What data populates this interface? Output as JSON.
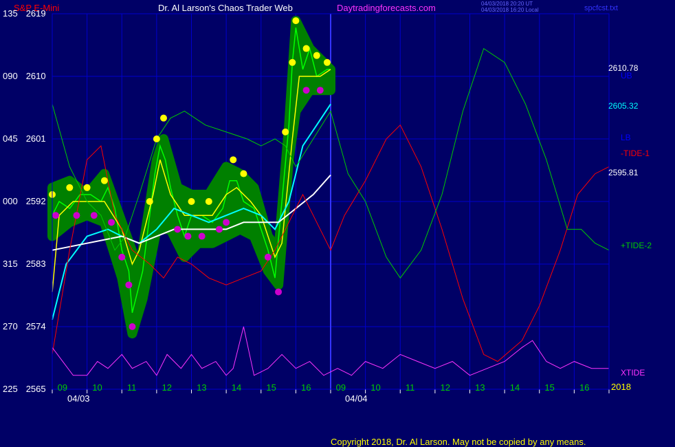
{
  "header": {
    "instrument": "S&P E-Mini",
    "title": "Dr. Al Larson's Chaos Trader Web",
    "site": "Daytradingforecasts.com",
    "stamp1": "04/03/2018 20:20 UT",
    "stamp2": "04/03/2018 16:20 Local",
    "file": "spcfcst.txt"
  },
  "colors": {
    "background": "#000066",
    "grid": "#0000cc",
    "price": "#00ff00",
    "band": "#008000",
    "highs": "#ffff00",
    "lows": "#cc00cc",
    "fast_ma": "#ffff00",
    "mid_ma": "#00ffff",
    "slow_ma": "#ffffff",
    "tide1": "#ff0000",
    "tide2": "#00cc00",
    "xtide": "#ff33ff"
  },
  "right_labels": {
    "ub": "UB",
    "ub_value": "2610.78",
    "ma_value": "2605.32",
    "lb": "LB",
    "tide1": "-TIDE-1",
    "last_value": "2595.81",
    "tide2": "+TIDE-2",
    "xtide": "XTIDE",
    "year": "2018"
  },
  "copyright": "Copyright 2018, Dr. Al Larson. May not be copied by any means.",
  "chart_data": {
    "type": "line",
    "y_ticks": [
      {
        "angle": "135",
        "price": "2619"
      },
      {
        "angle": "090",
        "price": "2610"
      },
      {
        "angle": "045",
        "price": "2601"
      },
      {
        "angle": "000",
        "price": "2592"
      },
      {
        "angle": "315",
        "price": "2583"
      },
      {
        "angle": "270",
        "price": "2574"
      },
      {
        "angle": "225",
        "price": "2565"
      }
    ],
    "x_ticks": [
      "09",
      "10",
      "11",
      "12",
      "13",
      "14",
      "15",
      "16",
      "09",
      "10",
      "11",
      "12",
      "13",
      "14",
      "15",
      "16"
    ],
    "dates": [
      "04/03",
      "04/04"
    ],
    "ylim": [
      2565,
      2619
    ],
    "hours_domain": [
      8,
      24
    ],
    "grid": true,
    "price_path": [
      [
        8.0,
        2590
      ],
      [
        8.2,
        2592
      ],
      [
        8.5,
        2591
      ],
      [
        8.8,
        2593
      ],
      [
        9.1,
        2593
      ],
      [
        9.4,
        2592
      ],
      [
        9.6,
        2594
      ],
      [
        9.8,
        2591
      ],
      [
        10.0,
        2585
      ],
      [
        10.2,
        2582
      ],
      [
        10.3,
        2576
      ],
      [
        10.4,
        2578
      ],
      [
        10.6,
        2582
      ],
      [
        10.8,
        2590
      ],
      [
        10.95,
        2596
      ],
      [
        11.1,
        2600
      ],
      [
        11.25,
        2598
      ],
      [
        11.4,
        2594
      ],
      [
        11.6,
        2590
      ],
      [
        11.8,
        2587
      ],
      [
        12.0,
        2590
      ],
      [
        12.3,
        2590
      ],
      [
        12.6,
        2589
      ],
      [
        12.9,
        2591
      ],
      [
        13.1,
        2595
      ],
      [
        13.3,
        2595
      ],
      [
        13.5,
        2592
      ],
      [
        13.8,
        2591
      ],
      [
        14.0,
        2588
      ],
      [
        14.2,
        2585
      ],
      [
        14.4,
        2581
      ],
      [
        14.6,
        2592
      ],
      [
        14.8,
        2603
      ],
      [
        14.9,
        2612
      ],
      [
        15.0,
        2617
      ],
      [
        15.2,
        2611
      ],
      [
        15.4,
        2614
      ],
      [
        15.6,
        2610
      ],
      [
        15.9,
        2611
      ],
      [
        16.0,
        2611
      ]
    ],
    "upper_channel": [
      [
        8.0,
        2594
      ],
      [
        8.5,
        2595
      ],
      [
        9.0,
        2593
      ],
      [
        9.5,
        2596
      ],
      [
        10.0,
        2589
      ],
      [
        10.5,
        2582
      ],
      [
        11.0,
        2598
      ],
      [
        11.2,
        2601
      ],
      [
        11.6,
        2594
      ],
      [
        12.0,
        2593
      ],
      [
        12.5,
        2593
      ],
      [
        13.0,
        2597
      ],
      [
        13.4,
        2596
      ],
      [
        13.8,
        2594
      ],
      [
        14.2,
        2587
      ],
      [
        14.5,
        2585
      ],
      [
        14.8,
        2603
      ],
      [
        15.0,
        2618
      ],
      [
        15.4,
        2614
      ],
      [
        15.8,
        2612
      ],
      [
        16.0,
        2611
      ]
    ],
    "lower_channel": [
      [
        8.0,
        2587
      ],
      [
        8.5,
        2589
      ],
      [
        9.0,
        2590
      ],
      [
        9.5,
        2589
      ],
      [
        10.0,
        2581
      ],
      [
        10.3,
        2573
      ],
      [
        10.6,
        2578
      ],
      [
        11.0,
        2588
      ],
      [
        11.4,
        2588
      ],
      [
        11.8,
        2584
      ],
      [
        12.2,
        2586
      ],
      [
        12.6,
        2586
      ],
      [
        13.0,
        2587
      ],
      [
        13.4,
        2588
      ],
      [
        13.8,
        2587
      ],
      [
        14.2,
        2582
      ],
      [
        14.5,
        2580
      ],
      [
        14.8,
        2598
      ],
      [
        15.0,
        2605
      ],
      [
        15.4,
        2608
      ],
      [
        15.8,
        2608
      ],
      [
        16.0,
        2608
      ]
    ],
    "highs": [
      [
        8.0,
        2593
      ],
      [
        8.5,
        2594
      ],
      [
        9.0,
        2594
      ],
      [
        9.5,
        2595
      ],
      [
        10.8,
        2592
      ],
      [
        11.0,
        2601
      ],
      [
        11.2,
        2604
      ],
      [
        12.0,
        2592
      ],
      [
        12.5,
        2592
      ],
      [
        13.2,
        2598
      ],
      [
        13.5,
        2596
      ],
      [
        14.7,
        2602
      ],
      [
        14.9,
        2612
      ],
      [
        15.0,
        2618
      ],
      [
        15.3,
        2614
      ],
      [
        15.6,
        2613
      ],
      [
        15.9,
        2612
      ]
    ],
    "lows": [
      [
        8.1,
        2590
      ],
      [
        8.7,
        2590
      ],
      [
        9.2,
        2590
      ],
      [
        9.7,
        2589
      ],
      [
        10.0,
        2584
      ],
      [
        10.2,
        2580
      ],
      [
        10.3,
        2574
      ],
      [
        11.6,
        2588
      ],
      [
        11.9,
        2587
      ],
      [
        12.3,
        2587
      ],
      [
        12.8,
        2588
      ],
      [
        13.0,
        2589
      ],
      [
        14.2,
        2584
      ],
      [
        14.5,
        2579
      ],
      [
        15.3,
        2608
      ],
      [
        15.7,
        2608
      ]
    ],
    "series": [
      {
        "name": "",
        "values": [
          [
            8.0,
            2579
          ],
          [
            8.2,
            2590
          ],
          [
            8.6,
            2592
          ],
          [
            9.0,
            2592
          ],
          [
            9.5,
            2592
          ],
          [
            10.0,
            2588
          ],
          [
            10.3,
            2583
          ],
          [
            10.5,
            2585
          ],
          [
            10.9,
            2593
          ],
          [
            11.1,
            2598
          ],
          [
            11.4,
            2593
          ],
          [
            11.8,
            2590
          ],
          [
            12.2,
            2590
          ],
          [
            12.6,
            2590
          ],
          [
            13.0,
            2593
          ],
          [
            13.3,
            2594
          ],
          [
            13.7,
            2592
          ],
          [
            14.0,
            2590
          ],
          [
            14.4,
            2584
          ],
          [
            14.6,
            2586
          ],
          [
            14.9,
            2601
          ],
          [
            15.1,
            2610
          ],
          [
            15.4,
            2610
          ],
          [
            15.7,
            2610
          ],
          [
            16.0,
            2611
          ]
        ]
      },
      {
        "name": "",
        "values": [
          [
            8.0,
            2575
          ],
          [
            8.4,
            2583
          ],
          [
            9.0,
            2587
          ],
          [
            9.6,
            2588
          ],
          [
            10.0,
            2587
          ],
          [
            10.5,
            2586
          ],
          [
            11.0,
            2588
          ],
          [
            11.5,
            2591
          ],
          [
            12.0,
            2590
          ],
          [
            12.5,
            2589
          ],
          [
            13.0,
            2590
          ],
          [
            13.5,
            2591
          ],
          [
            14.0,
            2590
          ],
          [
            14.4,
            2588
          ],
          [
            14.8,
            2592
          ],
          [
            15.2,
            2600
          ],
          [
            15.6,
            2603
          ],
          [
            16.0,
            2606
          ]
        ]
      },
      {
        "name": "",
        "values": [
          [
            8.0,
            2585
          ],
          [
            9.0,
            2586
          ],
          [
            10.0,
            2587
          ],
          [
            10.5,
            2586
          ],
          [
            11.0,
            2587
          ],
          [
            11.5,
            2588
          ],
          [
            12.0,
            2588
          ],
          [
            12.5,
            2588
          ],
          [
            13.0,
            2588
          ],
          [
            13.5,
            2589
          ],
          [
            14.0,
            2589
          ],
          [
            14.5,
            2589
          ],
          [
            15.0,
            2591
          ],
          [
            15.5,
            2593
          ],
          [
            16.0,
            2595.81
          ]
        ]
      },
      {
        "name": "-TIDE-1",
        "values": [
          [
            8.0,
            2570
          ],
          [
            8.5,
            2585
          ],
          [
            9.0,
            2598
          ],
          [
            9.4,
            2600
          ],
          [
            9.8,
            2590
          ],
          [
            10.3,
            2585
          ],
          [
            10.8,
            2583
          ],
          [
            11.2,
            2581
          ],
          [
            11.6,
            2584
          ],
          [
            12.0,
            2583
          ],
          [
            12.5,
            2581
          ],
          [
            13.0,
            2580
          ],
          [
            13.5,
            2581
          ],
          [
            14.0,
            2582
          ],
          [
            14.4,
            2585
          ],
          [
            14.8,
            2589
          ],
          [
            15.2,
            2593
          ],
          [
            15.5,
            2590
          ],
          [
            16.0,
            2585
          ],
          [
            16.4,
            2590
          ],
          [
            17.0,
            2595
          ],
          [
            17.6,
            2601
          ],
          [
            18.0,
            2603
          ],
          [
            18.6,
            2597
          ],
          [
            19.2,
            2588
          ],
          [
            19.8,
            2578
          ],
          [
            20.4,
            2570
          ],
          [
            20.8,
            2569
          ],
          [
            21.5,
            2572
          ],
          [
            22.0,
            2577
          ],
          [
            22.6,
            2585
          ],
          [
            23.1,
            2593
          ],
          [
            23.6,
            2596
          ],
          [
            24.0,
            2597
          ]
        ]
      },
      {
        "name": "+TIDE-2",
        "values": [
          [
            8.0,
            2606
          ],
          [
            8.5,
            2597
          ],
          [
            9.0,
            2592
          ],
          [
            9.4,
            2590
          ],
          [
            9.8,
            2585
          ],
          [
            10.1,
            2587
          ],
          [
            10.5,
            2593
          ],
          [
            11.0,
            2601
          ],
          [
            11.4,
            2604
          ],
          [
            11.8,
            2605
          ],
          [
            12.4,
            2603
          ],
          [
            13.0,
            2602
          ],
          [
            13.6,
            2601
          ],
          [
            14.0,
            2600
          ],
          [
            14.4,
            2601
          ],
          [
            14.7,
            2600
          ],
          [
            15.0,
            2597
          ],
          [
            15.5,
            2601
          ],
          [
            16.0,
            2605
          ],
          [
            16.5,
            2596
          ],
          [
            17.0,
            2592
          ],
          [
            17.6,
            2584
          ],
          [
            18.0,
            2581
          ],
          [
            18.6,
            2585
          ],
          [
            19.2,
            2593
          ],
          [
            19.8,
            2605
          ],
          [
            20.4,
            2614
          ],
          [
            21.0,
            2612
          ],
          [
            21.6,
            2606
          ],
          [
            22.2,
            2598
          ],
          [
            22.8,
            2588
          ],
          [
            23.2,
            2588
          ],
          [
            23.6,
            2586
          ],
          [
            24.0,
            2585
          ]
        ]
      },
      {
        "name": "XTIDE",
        "values": [
          [
            8.0,
            2571
          ],
          [
            8.3,
            2569
          ],
          [
            8.6,
            2567
          ],
          [
            9.0,
            2567
          ],
          [
            9.3,
            2569
          ],
          [
            9.6,
            2568
          ],
          [
            10.0,
            2570
          ],
          [
            10.3,
            2568
          ],
          [
            10.7,
            2569
          ],
          [
            11.0,
            2567
          ],
          [
            11.3,
            2570
          ],
          [
            11.7,
            2568
          ],
          [
            12.0,
            2570
          ],
          [
            12.3,
            2568
          ],
          [
            12.7,
            2569
          ],
          [
            13.0,
            2567
          ],
          [
            13.2,
            2568
          ],
          [
            13.5,
            2574
          ],
          [
            13.8,
            2567
          ],
          [
            14.2,
            2568
          ],
          [
            14.6,
            2570
          ],
          [
            15.0,
            2568
          ],
          [
            15.4,
            2569
          ],
          [
            15.8,
            2567
          ],
          [
            16.2,
            2568
          ],
          [
            16.6,
            2567
          ],
          [
            17.0,
            2569
          ],
          [
            17.5,
            2568
          ],
          [
            18.0,
            2570
          ],
          [
            18.5,
            2569
          ],
          [
            19.0,
            2568
          ],
          [
            19.5,
            2569
          ],
          [
            20.0,
            2567
          ],
          [
            20.5,
            2568
          ],
          [
            21.0,
            2569
          ],
          [
            21.5,
            2571
          ],
          [
            21.8,
            2572
          ],
          [
            22.2,
            2569
          ],
          [
            22.6,
            2568
          ],
          [
            23.0,
            2569
          ],
          [
            23.5,
            2568
          ],
          [
            24.0,
            2568
          ]
        ]
      }
    ]
  }
}
